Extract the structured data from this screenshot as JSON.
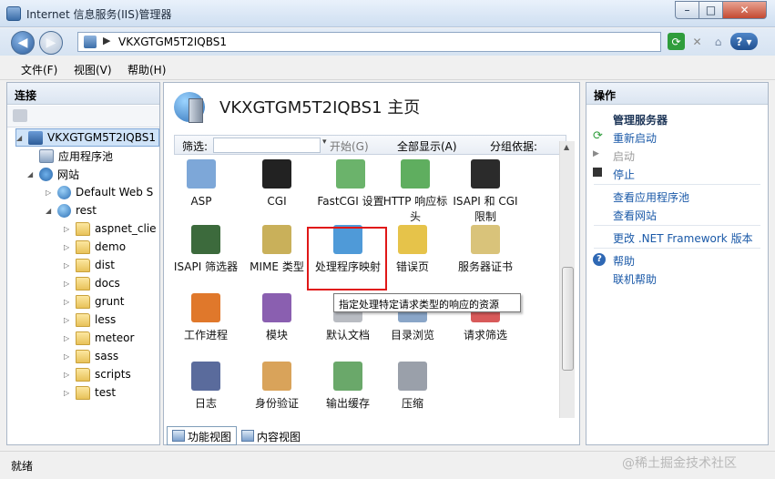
{
  "window": {
    "title": "Internet 信息服务(IIS)管理器"
  },
  "window_controls": {
    "minimize": "–",
    "maximize": "□",
    "close": "✕"
  },
  "nav": {
    "back": "◀",
    "forward": "▶",
    "separator": "▶",
    "address": "VKXGTGM5T2IQBS1",
    "refresh": "⟳",
    "stop": "✕",
    "home": "⌂",
    "help": "? ▾"
  },
  "menu": {
    "file": "文件(F)",
    "view": "视图(V)",
    "help": "帮助(H)"
  },
  "connections": {
    "header": "连接",
    "tree": [
      {
        "label": "VKXGTGM5T2IQBS1",
        "expander": "◢",
        "icon": "server-icon"
      },
      {
        "label": "应用程序池",
        "expander": "",
        "icon": "app-pool-icon"
      },
      {
        "label": "网站",
        "expander": "◢",
        "icon": "sites-icon"
      },
      {
        "label": "Default Web S",
        "expander": "▷",
        "icon": "globe-icon"
      },
      {
        "label": "rest",
        "expander": "◢",
        "icon": "globe-icon"
      },
      {
        "label": "aspnet_clie",
        "expander": "▷",
        "icon": "folder-icon"
      },
      {
        "label": "demo",
        "expander": "▷",
        "icon": "folder-icon"
      },
      {
        "label": "dist",
        "expander": "▷",
        "icon": "folder-icon"
      },
      {
        "label": "docs",
        "expander": "▷",
        "icon": "folder-icon"
      },
      {
        "label": "grunt",
        "expander": "▷",
        "icon": "folder-icon"
      },
      {
        "label": "less",
        "expander": "▷",
        "icon": "folder-icon"
      },
      {
        "label": "meteor",
        "expander": "▷",
        "icon": "folder-icon"
      },
      {
        "label": "sass",
        "expander": "▷",
        "icon": "folder-icon"
      },
      {
        "label": "scripts",
        "expander": "▷",
        "icon": "folder-icon"
      },
      {
        "label": "test",
        "expander": "▷",
        "icon": "folder-icon"
      }
    ]
  },
  "center": {
    "title": "VKXGTGM5T2IQBS1 主页",
    "filter_label": "筛选:",
    "filter_dropdown": "▾",
    "start_btn": "开始(G)",
    "show_all_btn": "全部显示(A)",
    "group_by_label": "分组依据:",
    "features": [
      {
        "label": "ASP",
        "icon": "asp-icon",
        "color": "#7da7d8"
      },
      {
        "label": "CGI",
        "icon": "cgi-icon",
        "color": "#222222"
      },
      {
        "label": "FastCGI 设置",
        "icon": "fastcgi-icon",
        "color": "#6bb36b"
      },
      {
        "label": "HTTP 响应标头",
        "icon": "http-headers-icon",
        "color": "#5fae5f"
      },
      {
        "label": "ISAPI 和 CGI 限制",
        "icon": "isapi-cgi-restrictions-icon",
        "color": "#2b2b2b"
      },
      {
        "label": "ISAPI 筛选器",
        "icon": "isapi-filters-icon",
        "color": "#3c6a3c"
      },
      {
        "label": "MIME 类型",
        "icon": "mime-types-icon",
        "color": "#c9b05a"
      },
      {
        "label": "处理程序映射",
        "icon": "handler-mappings-icon",
        "color": "#4f9ad8"
      },
      {
        "label": "错误页",
        "icon": "error-pages-icon",
        "color": "#e6c34a"
      },
      {
        "label": "服务器证书",
        "icon": "server-certificates-icon",
        "color": "#d9c37a"
      },
      {
        "label": "工作进程",
        "icon": "worker-processes-icon",
        "color": "#e0782b"
      },
      {
        "label": "模块",
        "icon": "modules-icon",
        "color": "#8a5fb0"
      },
      {
        "label": "默认文档",
        "icon": "default-document-icon",
        "color": "#b9bcc2"
      },
      {
        "label": "目录浏览",
        "icon": "directory-browsing-icon",
        "color": "#8aa6c8"
      },
      {
        "label": "请求筛选",
        "icon": "request-filtering-icon",
        "color": "#d85a5a"
      },
      {
        "label": "日志",
        "icon": "logging-icon",
        "color": "#5a6b9c"
      },
      {
        "label": "身份验证",
        "icon": "authentication-icon",
        "color": "#d9a35a"
      },
      {
        "label": "输出缓存",
        "icon": "output-caching-icon",
        "color": "#6aa86a"
      },
      {
        "label": "压缩",
        "icon": "compression-icon",
        "color": "#9aa0aa"
      }
    ],
    "tooltip": "指定处理特定请求类型的响应的资源",
    "tabs": {
      "features_view": "功能视图",
      "content_view": "内容视图"
    }
  },
  "actions": {
    "header": "操作",
    "manage_server": "管理服务器",
    "restart": "重新启动",
    "start": "启动",
    "stop": "停止",
    "view_app_pools": "查看应用程序池",
    "view_sites": "查看网站",
    "change_framework": "更改 .NET Framework 版本",
    "help": "帮助",
    "online_help": "联机帮助"
  },
  "status": {
    "text": "就绪"
  },
  "watermark": "@稀土掘金技术社区",
  "colors": {
    "accent_red": "#e01717",
    "link_blue": "#1a59a8",
    "selection": "#cfe3f8"
  }
}
